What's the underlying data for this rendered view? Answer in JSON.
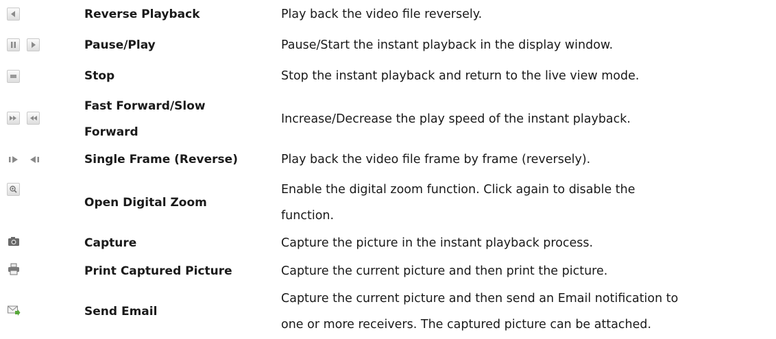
{
  "rows": [
    {
      "icons": [
        "reverse-playback-icon"
      ],
      "name": "Reverse Playback",
      "desc": [
        "Play back the video file reversely."
      ]
    },
    {
      "icons": [
        "pause-icon",
        "play-icon"
      ],
      "name": "Pause/Play",
      "desc": [
        "Pause/Start the instant playback in the display window."
      ]
    },
    {
      "icons": [
        "stop-icon"
      ],
      "name": "Stop",
      "desc": [
        "Stop the instant playback and return to the live view mode."
      ]
    },
    {
      "icons": [
        "fast-forward-icon",
        "slow-forward-icon"
      ],
      "name": "Fast Forward/Slow",
      "name2": "Forward",
      "desc": [
        "Increase/Decrease the play speed of the instant playback."
      ]
    },
    {
      "icons": [
        "single-frame-icon",
        "single-frame-reverse-icon"
      ],
      "name": "Single Frame (Reverse)",
      "desc": [
        "Play back the video file frame by frame (reversely)."
      ]
    },
    {
      "icons": [
        "digital-zoom-icon"
      ],
      "name": "Open Digital Zoom",
      "desc": [
        "Enable the digital zoom function. Click again to disable the",
        "function."
      ]
    },
    {
      "icons": [
        "capture-camera-icon"
      ],
      "name": "Capture",
      "desc": [
        "Capture the picture in the instant playback process."
      ]
    },
    {
      "icons": [
        "printer-icon"
      ],
      "name": "Print Captured Picture",
      "desc": [
        "Capture the current picture and then print the picture."
      ]
    },
    {
      "icons": [
        "send-email-icon"
      ],
      "name": "Send Email",
      "desc": [
        "Capture the current picture and then send an Email notification to",
        "one or more receivers. The captured picture can be attached."
      ]
    }
  ]
}
